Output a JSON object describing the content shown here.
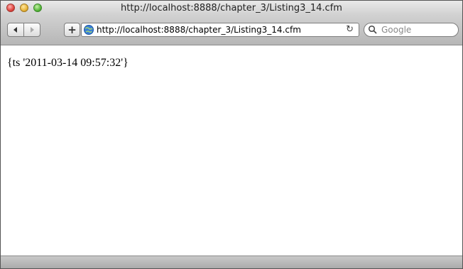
{
  "window": {
    "title": "http://localhost:8888/chapter_3/Listing3_14.cfm"
  },
  "toolbar": {
    "address_value": "http://localhost:8888/chapter_3/Listing3_14.cfm",
    "search_placeholder": "Google",
    "add_label": "+",
    "reload_label": "↻"
  },
  "page": {
    "output_text": "{ts '2011-03-14 09:57:32'}"
  }
}
